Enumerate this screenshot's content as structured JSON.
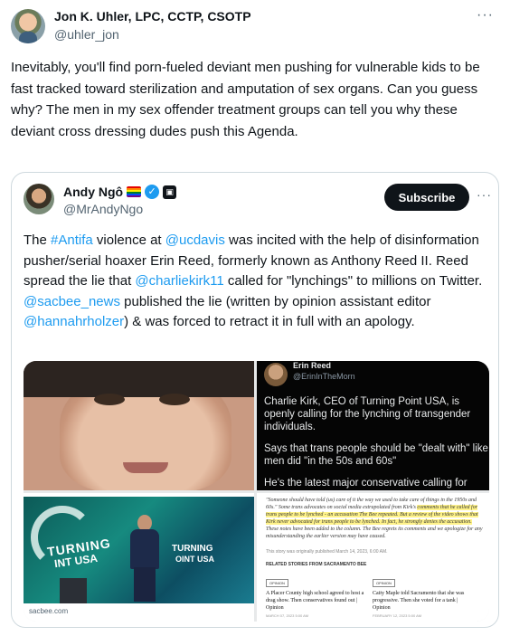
{
  "post": {
    "author_name": "Jon K. Uhler, LPC, CCTP, CSOTP",
    "author_handle": "@uhler_jon",
    "more": "···",
    "text": "Inevitably, you'll find porn-fueled deviant men pushing for vulnerable kids to be fast tracked toward sterilization and amputation of sex organs. Can you guess why? The men in my sex offender treatment groups can tell you why these deviant cross dressing dudes push this Agenda."
  },
  "quote": {
    "author_name": "Andy Ngô",
    "author_handle": "@MrAndyNgo",
    "verified_mark": "✓",
    "affiliate_mark": "▣",
    "subscribe_label": "Subscribe",
    "more": "···",
    "text": {
      "t1": "The ",
      "l1": "#Antifa",
      "t2": " violence at ",
      "l2": "@ucdavis",
      "t3": " was incited with the help of disinformation pusher/serial hoaxer Erin Reed, formerly known as Anthony Reed II. Reed spread the lie that ",
      "l3": "@charliekirk11",
      "t4": " called for \"lynchings\" to millions on Twitter. ",
      "l4": "@sacbee_news",
      "t5": " published the lie (written by opinion assistant editor ",
      "l5": "@hannahrholzer",
      "t6": ") & was forced to retract it in full with an apology."
    },
    "media": {
      "tweet_name": "Erin Reed",
      "tweet_handle": "@ErinInTheMorn",
      "tweet_p1": "Charlie Kirk, CEO of Turning Point USA, is openly calling for the lynching of transgender individuals.",
      "tweet_p2": "Says that trans people should be \"dealt with\" like men did \"in the 50s and 60s\"",
      "tweet_p3": "He's the latest major conservative calling for",
      "stage_logo1a": "TURNING",
      "stage_logo1b": "INT USA",
      "stage_logo2a": "TURNING",
      "stage_logo2b": "OINT USA",
      "source": "sacbee.com",
      "article_line1": "\"Someone should have told (us) care of it the way we used to take care of things in the 1950s and 60s.\" Some trans advocates on social media extrapolated from Kirk's",
      "article_highlight": "comments that he called for trans people to be lynched - an accusation The Bee repeated. But a review of the video shows that Kirk never advocated for trans people to be lynched. In fact, he strongly denies the accusation.",
      "article_line2": "These notes have been added to the column. The Bee regrets its comments and we apologize for any misunderstanding the earlier version may have caused.",
      "article_note": "This story was originally published March 14, 2023, 6:00 AM.",
      "related_heading": "RELATED STORIES FROM SACRAMENTO BEE",
      "card1_tag": "OPINION",
      "card1_text": "A Placer County high school agreed to host a drag show. Then conservatives found out | Opinion",
      "card1_date": "MARCH 07, 2023 5:00 AM",
      "card2_tag": "OPINION",
      "card2_text": "Caity Maple told Sacramento that she was progressive. Then she voted for a tank | Opinion",
      "card2_date": "FEBRUARY 12, 2023 5:00 AM"
    }
  },
  "colors": {
    "link": "#1d9bf0",
    "text": "#0f1419",
    "secondary": "#536471",
    "border": "#cfd9de"
  }
}
